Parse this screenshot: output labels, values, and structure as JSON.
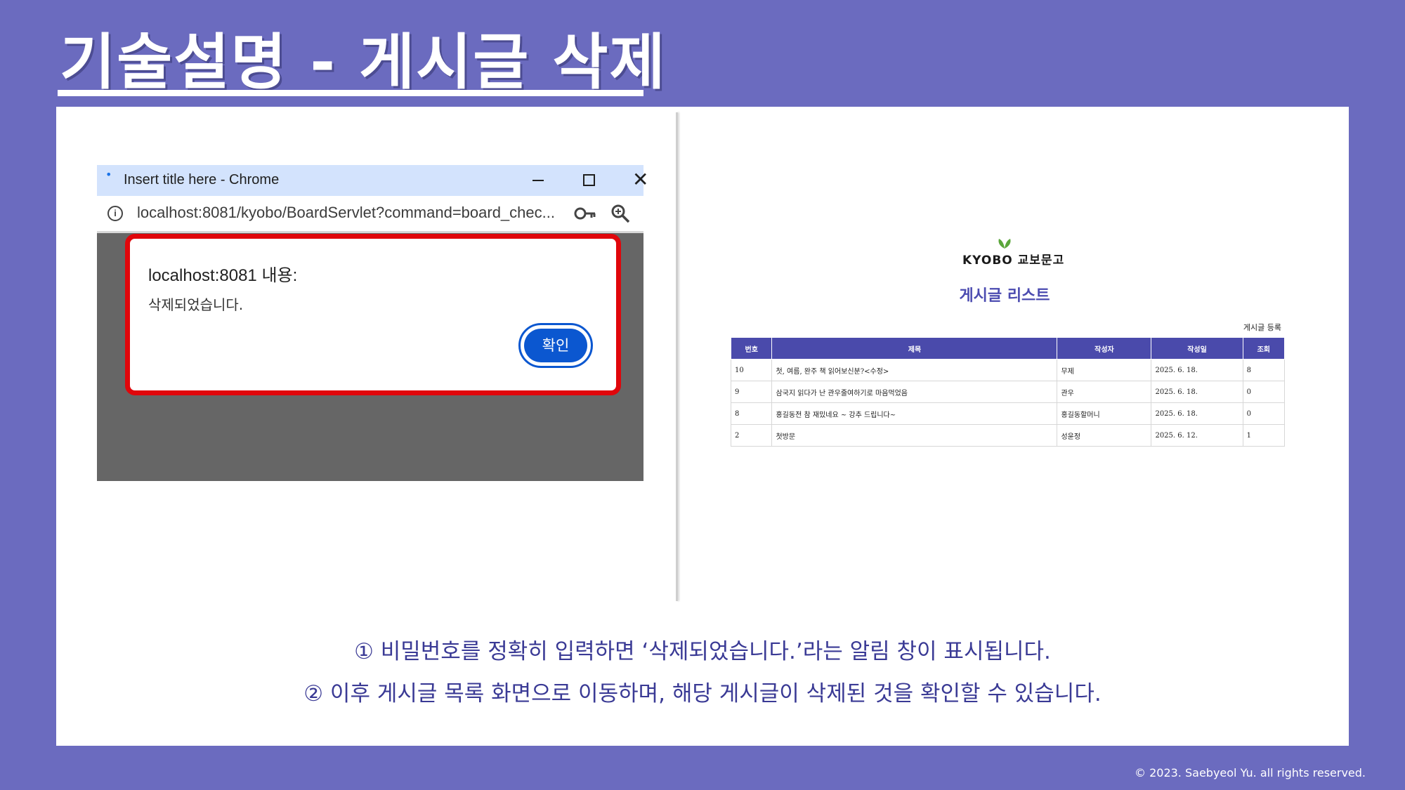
{
  "slide": {
    "title": "기술설명 - 게시글 삭제",
    "description": [
      "① 비밀번호를 정확히 입력하면 ‘삭제되었습니다.’라는 알림 창이 표시됩니다.",
      "② 이후 게시글 목록 화면으로 이동하며, 해당 게시글이 삭제된 것을 확인할 수 있습니다."
    ],
    "copyright": "© 2023. Saebyeol Yu. all rights reserved."
  },
  "popup": {
    "window_title": "Insert title here - Chrome",
    "url": "localhost:8081/kyobo/BoardServlet?command=board_chec...",
    "icons": [
      "info-icon",
      "key-icon",
      "zoom-icon",
      "minimize-icon",
      "maximize-icon",
      "close-icon"
    ],
    "alert": {
      "heading": "localhost:8081 내용:",
      "message": "삭제되었습니다.",
      "confirm_label": "확인"
    }
  },
  "board": {
    "logo_text": "KYOBO 교보문고",
    "title": "게시글 리스트",
    "write_link": "게시글 등록",
    "columns": [
      "번호",
      "제목",
      "작성자",
      "작성일",
      "조회"
    ],
    "rows": [
      [
        "10",
        "첫, 여름, 완주 책 읽어보신분?<수정>",
        "무제",
        "2025. 6. 18.",
        "8"
      ],
      [
        "9",
        "삼국지 읽다가 난 관우줄여하기로 마음먹었음",
        "관우",
        "2025. 6. 18.",
        "0"
      ],
      [
        "8",
        "홍길동전 참 재밌네요 ~ 강추 드립니다~",
        "홍길동할머니",
        "2025. 6. 18.",
        "0"
      ],
      [
        "2",
        "첫방문",
        "성윤정",
        "2025. 6. 12.",
        "1"
      ]
    ]
  },
  "colors": {
    "background": "#6b6bbf",
    "accent": "#4a4aab",
    "alert_border": "#e0060b",
    "confirm_button": "#0b57d0",
    "logo_leaf": "#5aa63a"
  }
}
